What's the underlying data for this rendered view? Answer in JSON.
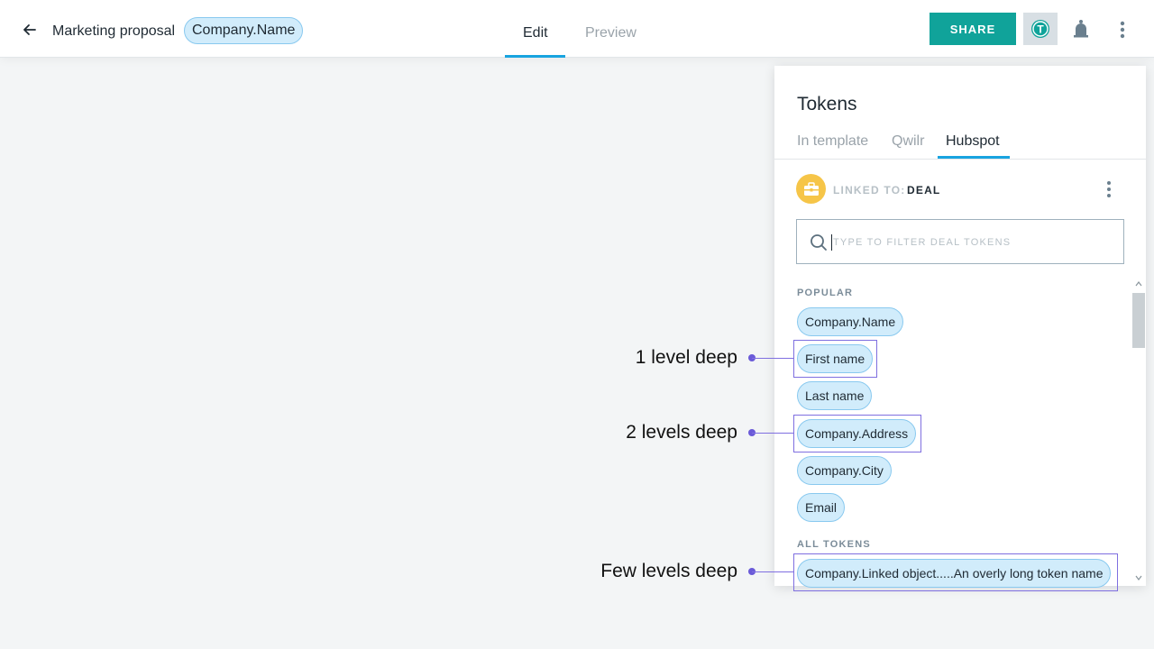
{
  "header": {
    "doc_title": "Marketing proposal",
    "title_token": "Company.Name",
    "tabs": [
      {
        "label": "Edit",
        "active": true
      },
      {
        "label": "Preview",
        "active": false
      }
    ],
    "share_label": "SHARE",
    "tokens_toggle_glyph": "T"
  },
  "panel": {
    "title": "Tokens",
    "tabs": [
      {
        "label": "In template",
        "active": false
      },
      {
        "label": "Qwilr",
        "active": false
      },
      {
        "label": "Hubspot",
        "active": true
      }
    ],
    "linked_label": "LINKED TO:",
    "linked_value": "DEAL",
    "search_placeholder": "TYPE TO FILTER DEAL TOKENS",
    "search_value": "",
    "popular_label": "POPULAR",
    "popular_tokens": [
      "Company.Name",
      "First name",
      "Last name",
      "Company.Address",
      "Company.City",
      "Email"
    ],
    "all_label": "ALL TOKENS",
    "all_tokens": [
      "Company.Linked object.....An overly long token name"
    ]
  },
  "annotations": [
    {
      "label": "1 level deep"
    },
    {
      "label": "2 levels deep"
    },
    {
      "label": "Few levels deep"
    }
  ],
  "colors": {
    "accent": "#19a4e0",
    "share": "#10a39a",
    "token_bg": "#d1ecfb",
    "token_border": "#89c9ef",
    "annotation": "#7f6fe0",
    "linked_icon": "#f6c548"
  }
}
